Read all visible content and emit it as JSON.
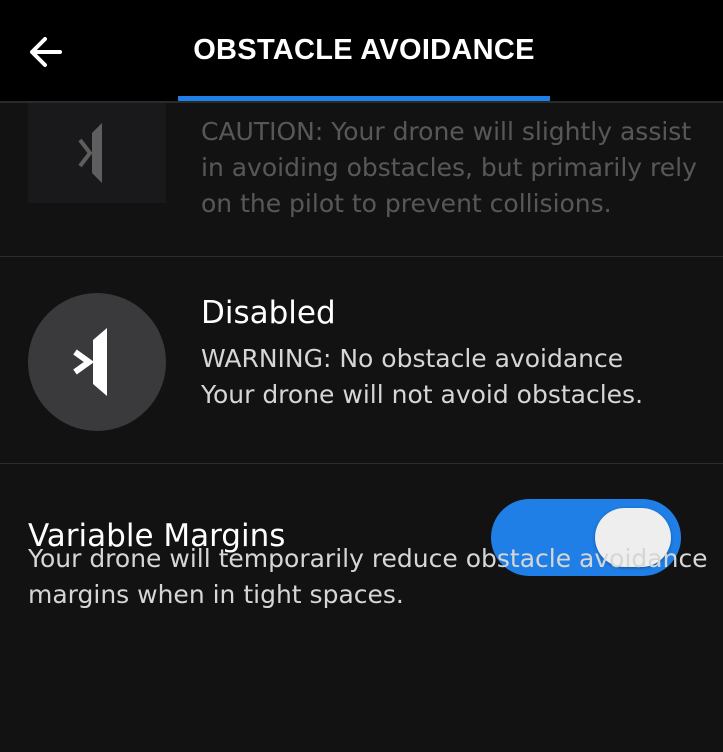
{
  "header": {
    "back_icon": "arrow-left-icon",
    "title": "OBSTACLE AVOIDANCE",
    "accent_color": "#1f7fe6"
  },
  "options": {
    "caution": {
      "icon": "obstacle-avoidance-partial-icon",
      "text": "CAUTION: Your drone will slightly assist in avoiding obstacles, but primarily rely on the pilot to prevent collisions."
    },
    "disabled": {
      "icon": "obstacle-avoidance-disabled-icon",
      "title": "Disabled",
      "warning": "WARNING: No obstacle avoidance",
      "description": "Your drone will not avoid obstacles."
    }
  },
  "variable_margins": {
    "label": "Variable Margins",
    "toggle_on": true,
    "toggle_color": "#1f7fe6",
    "description": "Your drone will temporarily reduce obstacle avoidance margins when in tight spaces."
  }
}
